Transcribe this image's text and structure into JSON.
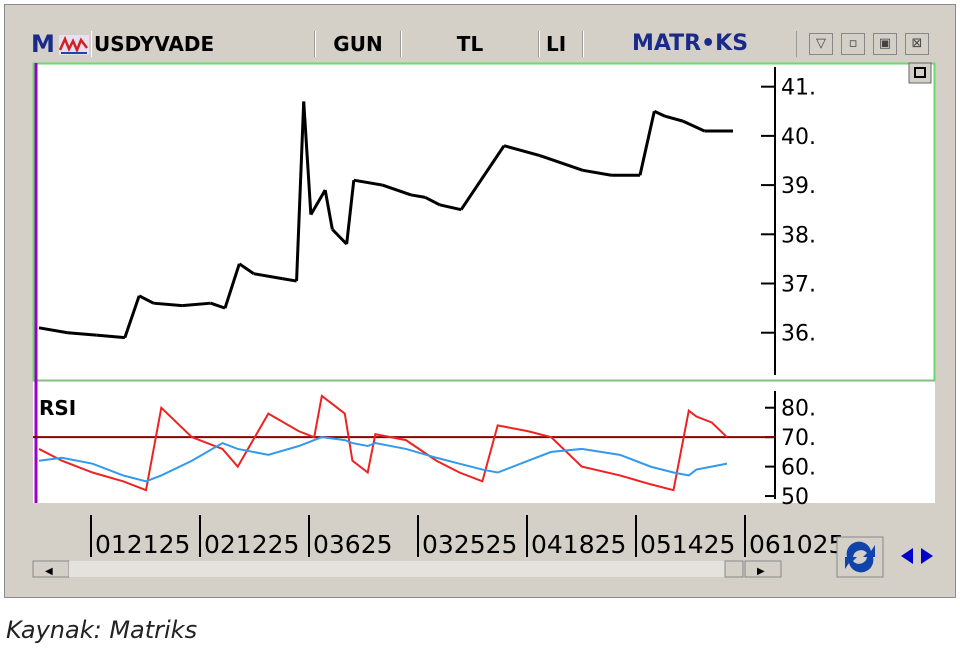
{
  "window": {
    "app_letter": "M",
    "symbol": "USDYVADE",
    "period": "GUN",
    "currency": "TL",
    "type_cut": "LI",
    "brand": "MATR•KS",
    "colors": {
      "price": "#000000",
      "rsi": "#ee2222",
      "rsi_signal": "#3399ee",
      "level": "#880000",
      "frame": "#66dd66",
      "cursor": "#9900cc"
    }
  },
  "icons": [
    "app-logo-icon",
    "chart-wave-icon",
    "dropdown-icon",
    "minimize-icon",
    "restore-icon",
    "close-icon",
    "maximize-panel-icon",
    "refresh-icon",
    "scroll-left-icon",
    "scroll-right-icon"
  ],
  "rsi_label": "RSI",
  "caption": "Kaynak: Matriks",
  "chart_data": [
    {
      "type": "line",
      "title": "",
      "y_axis_side": "right",
      "y_ticks": [
        "41.",
        "40.",
        "39.",
        "38.",
        "37.",
        "36."
      ],
      "ylim": [
        35.1,
        41.4
      ],
      "x_ticks": [
        "012125",
        "021225",
        "03625",
        "032525",
        "041825",
        "051425",
        "061025"
      ],
      "x": [
        0,
        8,
        16,
        24,
        28,
        32,
        40,
        48,
        52,
        56,
        60,
        68,
        72,
        74,
        76,
        80,
        82,
        86,
        88,
        96,
        104,
        108,
        112,
        118,
        130,
        140,
        152,
        160,
        168,
        172,
        175,
        180,
        186,
        194
      ],
      "series": [
        {
          "values": [
            36.1,
            36.0,
            35.95,
            35.9,
            36.75,
            36.6,
            36.55,
            36.6,
            36.5,
            37.4,
            37.2,
            37.1,
            37.05,
            40.7,
            38.4,
            38.9,
            38.1,
            37.8,
            39.1,
            39.0,
            38.8,
            38.75,
            38.6,
            38.5,
            39.8,
            39.6,
            39.3,
            39.2,
            39.2,
            40.5,
            40.4,
            40.3,
            40.1,
            40.1
          ]
        }
      ]
    },
    {
      "type": "line",
      "title": "RSI",
      "y_axis_side": "right",
      "y_ticks": [
        "80.",
        "70.",
        "60.",
        "50"
      ],
      "ylim": [
        49,
        85
      ],
      "hline": 70,
      "x": [
        0,
        6,
        14,
        22,
        28,
        32,
        40,
        48,
        52,
        60,
        68,
        72,
        74,
        80,
        82,
        86,
        88,
        96,
        104,
        110,
        116,
        120,
        128,
        134,
        142,
        152,
        160,
        166,
        170,
        172,
        176,
        180
      ],
      "series": [
        {
          "name": "RSI",
          "values": [
            66,
            62,
            58,
            55,
            52,
            80,
            70,
            66,
            60,
            78,
            72,
            70,
            84,
            78,
            62,
            58,
            71,
            69,
            62,
            58,
            55,
            74,
            72,
            70,
            60,
            57,
            54,
            52,
            79,
            77,
            75,
            70
          ]
        },
        {
          "name": "signal",
          "values": [
            62,
            63,
            61,
            57,
            55,
            57,
            62,
            68,
            66,
            64,
            67,
            69,
            70,
            69,
            68,
            67,
            68,
            66,
            63,
            61,
            59,
            58,
            62,
            65,
            66,
            64,
            60,
            58,
            57,
            59,
            60,
            61
          ]
        }
      ]
    }
  ]
}
